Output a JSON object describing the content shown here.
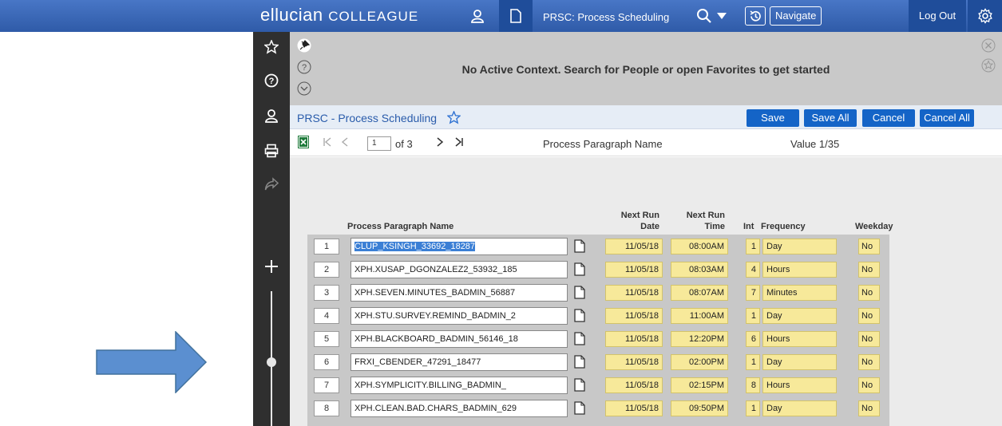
{
  "header": {
    "brand": "ellucian",
    "product": "COLLEAGUE",
    "form_title": "PRSC: Process Scheduling",
    "navigate_label": "Navigate",
    "logout_label": "Log Out"
  },
  "context": {
    "message": "No Active Context. Search for People or open Favorites to get started"
  },
  "form": {
    "title": "PRSC - Process Scheduling",
    "buttons": {
      "save": "Save",
      "save_all": "Save All",
      "cancel": "Cancel",
      "cancel_all": "Cancel All"
    }
  },
  "pager": {
    "page_value": "1",
    "of_text": "of 3",
    "field_label": "Process Paragraph Name",
    "value_text": "Value 1/35"
  },
  "columns": {
    "name": "Process Paragraph Name",
    "next_run_date_1": "Next Run",
    "next_run_date_2": "Date",
    "next_run_time_1": "Next Run",
    "next_run_time_2": "Time",
    "int": "Int",
    "frequency": "Frequency",
    "weekday": "Weekday"
  },
  "rows": [
    {
      "num": "1",
      "name": "CLUP_KSINGH_33692_18287",
      "date": "11/05/18",
      "time": "08:00AM",
      "int": "1",
      "freq": "Day",
      "weekday": "No"
    },
    {
      "num": "2",
      "name": "XPH.XUSAP_DGONZALEZ2_53932_185",
      "date": "11/05/18",
      "time": "08:03AM",
      "int": "4",
      "freq": "Hours",
      "weekday": "No"
    },
    {
      "num": "3",
      "name": "XPH.SEVEN.MINUTES_BADMIN_56887",
      "date": "11/05/18",
      "time": "08:07AM",
      "int": "7",
      "freq": "Minutes",
      "weekday": "No"
    },
    {
      "num": "4",
      "name": "XPH.STU.SURVEY.REMIND_BADMIN_2",
      "date": "11/05/18",
      "time": "11:00AM",
      "int": "1",
      "freq": "Day",
      "weekday": "No"
    },
    {
      "num": "5",
      "name": "XPH.BLACKBOARD_BADMIN_56146_18",
      "date": "11/05/18",
      "time": "12:20PM",
      "int": "6",
      "freq": "Hours",
      "weekday": "No"
    },
    {
      "num": "6",
      "name": "FRXI_CBENDER_47291_18477",
      "date": "11/05/18",
      "time": "02:00PM",
      "int": "1",
      "freq": "Day",
      "weekday": "No"
    },
    {
      "num": "7",
      "name": "XPH.SYMPLICITY.BILLING_BADMIN_",
      "date": "11/05/18",
      "time": "02:15PM",
      "int": "8",
      "freq": "Hours",
      "weekday": "No"
    },
    {
      "num": "8",
      "name": "XPH.CLEAN.BAD.CHARS_BADMIN_629",
      "date": "11/05/18",
      "time": "09:50PM",
      "int": "1",
      "freq": "Day",
      "weekday": "No"
    }
  ],
  "colors": {
    "topbar": "#2f5ba8",
    "rail": "#2f2f2f",
    "button": "#1464c7",
    "yellow_cell": "#f7e99a",
    "arrow": "#5b8fd0"
  }
}
